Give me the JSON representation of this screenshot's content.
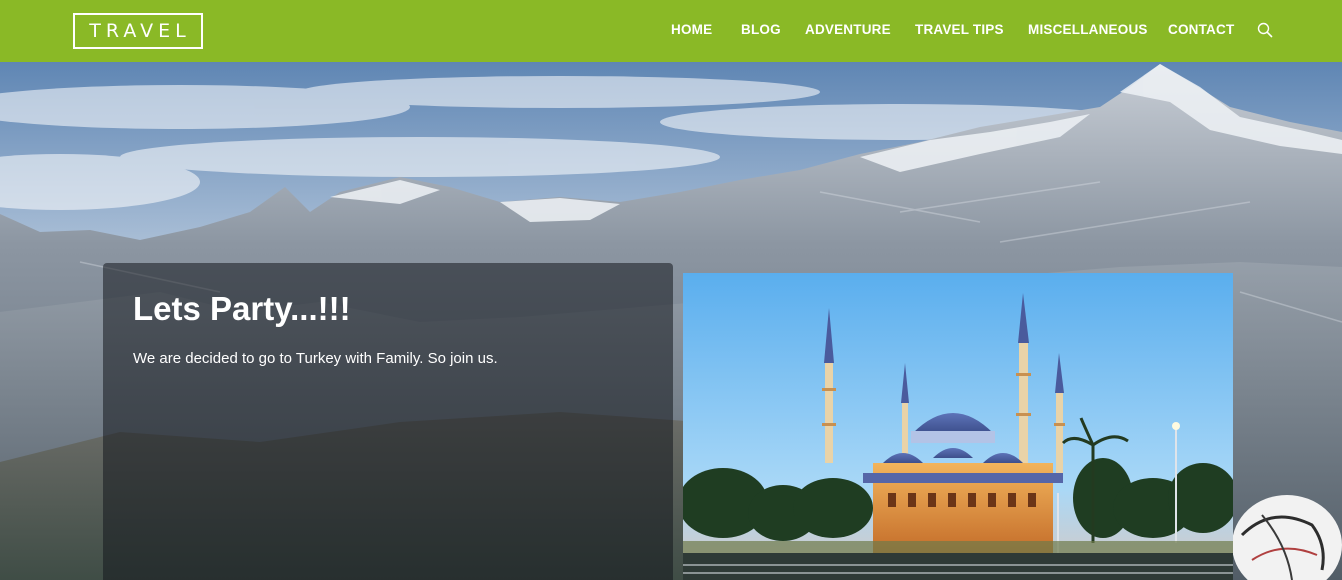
{
  "header": {
    "logo": "TRAVEL",
    "nav": [
      "HOME",
      "BLOG",
      "ADVENTURE",
      "TRAVEL TIPS",
      "MISCELLANEOUS",
      "CONTACT"
    ],
    "search_icon": "search-icon"
  },
  "post": {
    "title": "Lets Party...!!!",
    "excerpt": "We are decided to go to Turkey with Family. So join us."
  },
  "colors": {
    "header_bg": "#8ab926",
    "text": "#ffffff",
    "card_overlay": "rgba(20,24,30,0.55)"
  }
}
